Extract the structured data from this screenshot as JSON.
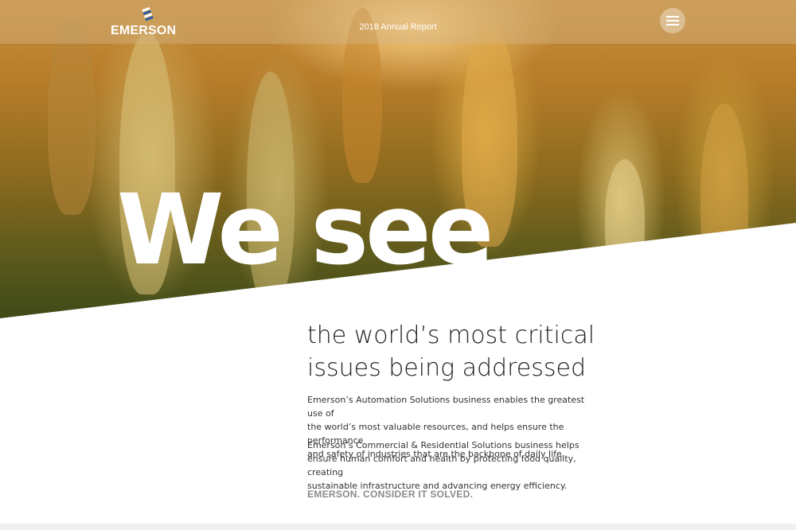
{
  "header": {
    "brand": "EMERSON",
    "report_title": "2018 Annual Report",
    "menu_icon": "hamburger-menu-icon"
  },
  "hero": {
    "headline": "We see"
  },
  "content": {
    "subhead_line1": "the world’s most critical",
    "subhead_line2": "issues being addressed",
    "paragraph1_line1": "Emerson’s Automation Solutions business enables the greatest use of",
    "paragraph1_line2": "the world’s most valuable resources, and helps ensure the performance",
    "paragraph1_line3": "and safety of industries that are the backbone of daily life.",
    "paragraph2_line1": "Emerson’s Commercial & Residential Solutions business helps",
    "paragraph2_line2": "ensure human comfort and health by protecting food quality, creating",
    "paragraph2_line3": "sustainable infrastructure and advancing energy efficiency.",
    "tagline": "EMERSON. CONSIDER IT SOLVED."
  },
  "colors": {
    "accent": "#2a5aa8",
    "wheat_gold": "#c98e3a"
  }
}
